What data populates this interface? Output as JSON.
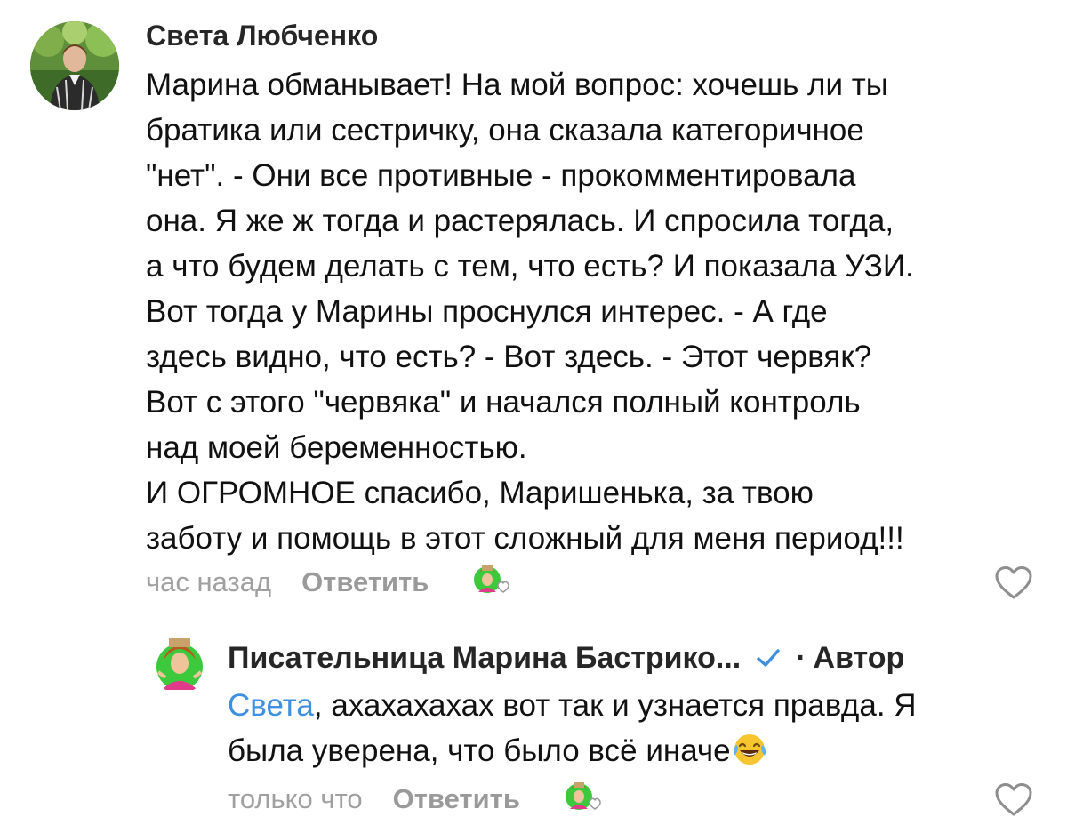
{
  "comments": [
    {
      "author": "Света Любченко",
      "text_lines": [
        "Марина обманывает! На мой вопрос: хочешь ли ты",
        "братика или сестричку, она сказала категоричное",
        "\"нет\". - Они все противные - прокомментировала",
        "она. Я же ж тогда и растерялась. И спросила тогда,",
        "а что будем делать с тем, что есть? И показала УЗИ.",
        "Вот тогда у Марины проснулся интерес. - А где",
        "здесь видно, что есть? - Вот здесь. - Этот червяк?",
        "Вот с этого \"червяка\" и начался полный контроль",
        "над моей беременностью.",
        "И ОГРОМНОЕ спасибо, Маришенька, за твою",
        "заботу и помощь в этот сложный для меня период!!!"
      ],
      "time": "час назад",
      "reply_label": "Ответить"
    },
    {
      "author": "Писательница Марина Бастрико...",
      "separator": "·",
      "author_tag": "Автор",
      "mention": "Света",
      "text_line1_rest": ", ахахахахах вот так и узнается правда. Я",
      "text_line2": "была уверена, что было всё иначе",
      "time": "только что",
      "reply_label": "Ответить"
    }
  ],
  "icons": {
    "verified": "verified-check-icon",
    "like": "heart-outline-icon",
    "laugh": "tears-of-joy-emoji-icon"
  },
  "colors": {
    "mention": "#3d8fe0",
    "meta_gray": "#a0a0a0",
    "verified": "#3d8fe0"
  }
}
